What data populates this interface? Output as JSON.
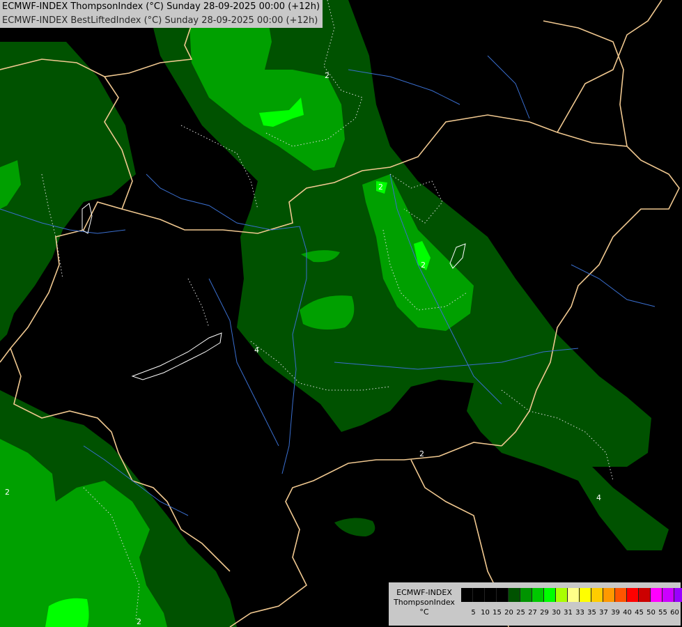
{
  "header": {
    "line1": "ECMWF-INDEX ThompsonIndex (°C) Sunday 28-09-2025 00:00 (+12h)",
    "line2": "ECMWF-INDEX BestLiftedIndex (°C) Sunday 28-09-2025 00:00 (+12h)"
  },
  "legend": {
    "model": "ECMWF-INDEX",
    "index": "ThompsonIndex",
    "unit": "°C",
    "colors": [
      "#000000",
      "#000000",
      "#000000",
      "#000000",
      "#005200",
      "#009400",
      "#00c800",
      "#00ff00",
      "#aaff00",
      "#ffff88",
      "#ffff00",
      "#ffcc00",
      "#ff9900",
      "#ff5500",
      "#ff0000",
      "#cc0000",
      "#ff00ff",
      "#cc00ff",
      "#9900ff",
      "#6600ff",
      "#0000ff"
    ],
    "ticks": [
      "5",
      "10",
      "15",
      "20",
      "25",
      "27",
      "29",
      "30",
      "31",
      "33",
      "35",
      "37",
      "39",
      "40",
      "45",
      "50",
      "55",
      "60"
    ]
  },
  "contours": {
    "label_2": "2",
    "label_4": "4"
  }
}
